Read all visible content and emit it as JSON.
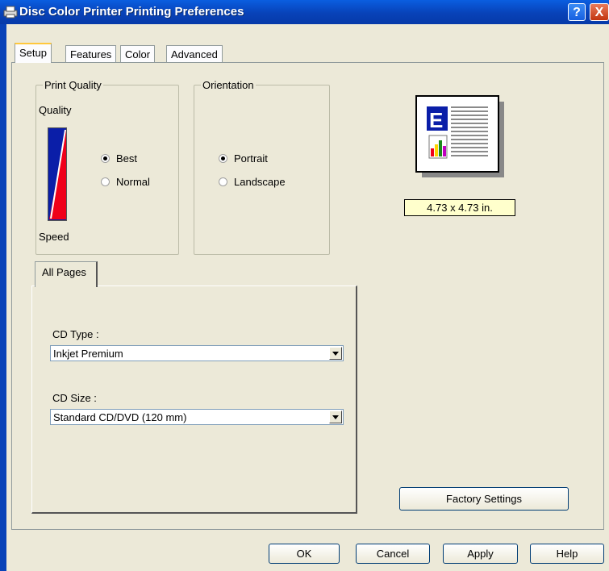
{
  "window": {
    "title": "Disc Color Printer Printing Preferences",
    "help_label": "?",
    "close_label": "X"
  },
  "tabs": [
    "Setup",
    "Features",
    "Color",
    "Advanced"
  ],
  "print_quality": {
    "legend": "Print Quality",
    "top_label": "Quality",
    "bottom_label": "Speed",
    "options": [
      "Best",
      "Normal"
    ],
    "selected": "Best"
  },
  "orientation": {
    "legend": "Orientation",
    "options": [
      "Portrait",
      "Landscape"
    ],
    "selected": "Portrait"
  },
  "preview": {
    "icon": "document-preview-icon",
    "letter": "E",
    "size_text": "4.73 x 4.73 in."
  },
  "pages_tab": {
    "label": "All Pages"
  },
  "cd_type": {
    "label": "CD Type :",
    "value": "Inkjet Premium"
  },
  "cd_size": {
    "label": "CD Size :",
    "value": "Standard CD/DVD (120 mm)"
  },
  "buttons": {
    "factory": "Factory Settings",
    "ok": "OK",
    "cancel": "Cancel",
    "apply": "Apply",
    "help": "Help"
  },
  "colors": {
    "titlebar": "#0842b8",
    "dialog": "#ece9d8",
    "tab_highlight": "#ffc83c",
    "size_label_bg": "#ffffcc"
  }
}
